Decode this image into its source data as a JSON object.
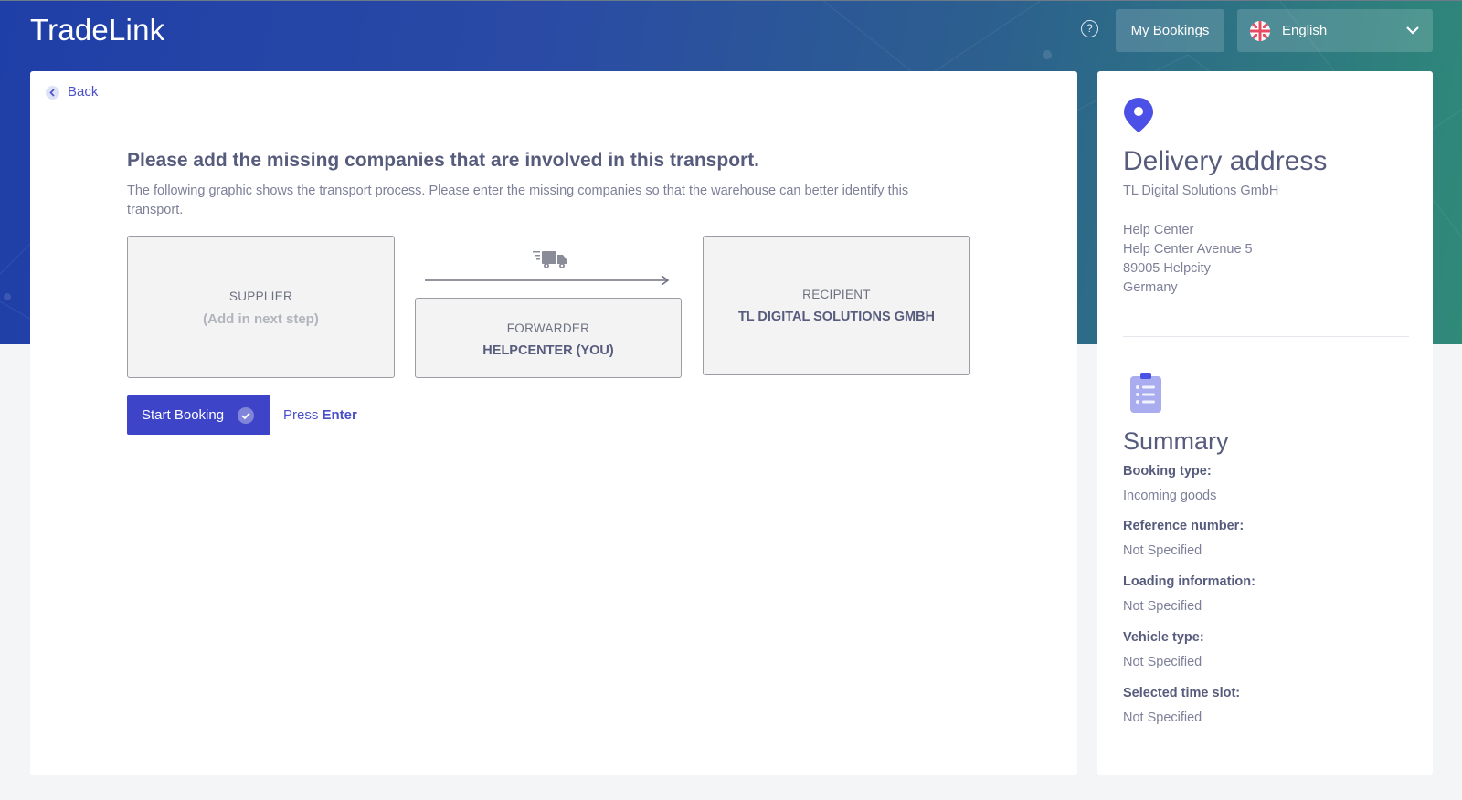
{
  "header": {
    "brand": "TradeLink",
    "help_icon": "question-circle-icon",
    "my_bookings_label": "My Bookings",
    "language": {
      "selected": "English",
      "flag_icon": "uk-flag-icon",
      "chevron_icon": "chevron-down-icon"
    }
  },
  "main": {
    "back_label": "Back",
    "heading": "Please add the missing companies that are involved in this transport.",
    "subtext": "The following graphic shows the transport process. Please enter the missing companies so that the warehouse can better identify this transport.",
    "process": {
      "supplier": {
        "role": "SUPPLIER",
        "company": "(Add in next step)"
      },
      "forwarder": {
        "role": "FORWARDER",
        "company": "HELPCENTER (YOU)"
      },
      "recipient": {
        "role": "RECIPIENT",
        "company": "TL DIGITAL SOLUTIONS GMBH"
      },
      "icons": {
        "transport": "truck-icon",
        "direction": "arrow-right-icon"
      }
    },
    "start_booking_label": "Start Booking",
    "press_prefix": "Press",
    "press_key": "Enter"
  },
  "sidebar": {
    "delivery": {
      "icon": "map-pin-icon",
      "title": "Delivery address",
      "company": "TL Digital Solutions GmbH",
      "lines": [
        "Help Center",
        "Help Center Avenue 5",
        "89005 Helpcity",
        "Germany"
      ]
    },
    "summary": {
      "icon": "clipboard-list-icon",
      "title": "Summary",
      "items": [
        {
          "label": "Booking type:",
          "value": "Incoming goods"
        },
        {
          "label": "Reference number:",
          "value": "Not Specified"
        },
        {
          "label": "Loading information:",
          "value": "Not Specified"
        },
        {
          "label": "Vehicle type:",
          "value": "Not Specified"
        },
        {
          "label": "Selected time slot:",
          "value": "Not Specified"
        }
      ]
    }
  },
  "colors": {
    "accent": "#3d44c7",
    "heading": "#575c7d",
    "hero_start": "#1f3fa8",
    "hero_end": "#2f8a78"
  }
}
